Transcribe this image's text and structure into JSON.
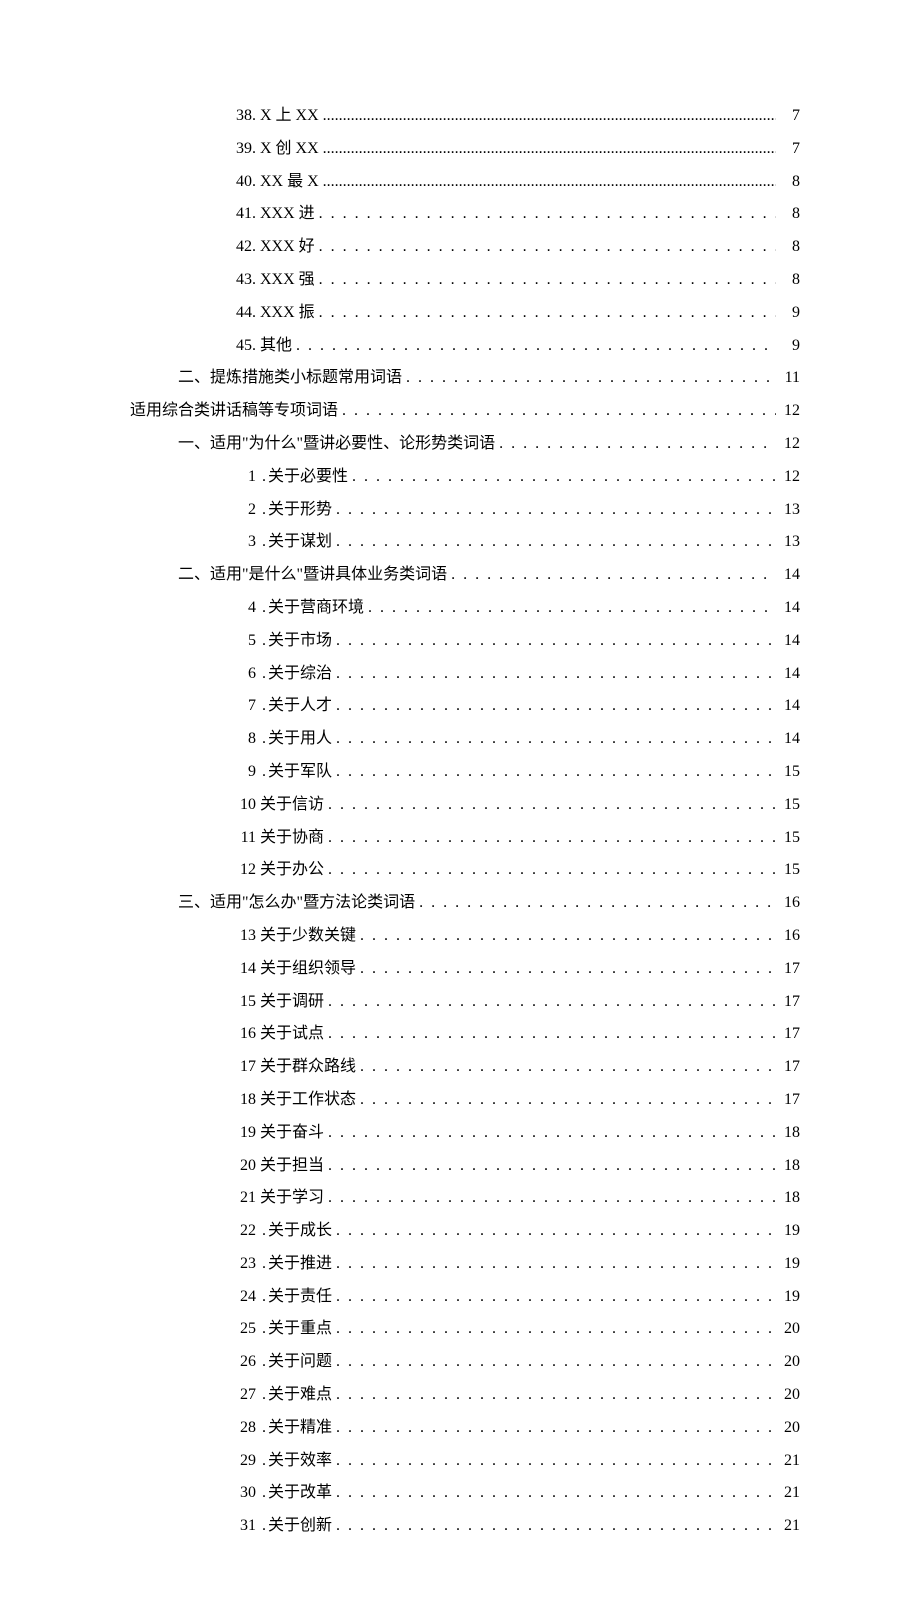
{
  "toc": [
    {
      "indent": 2,
      "num": "38.",
      "sep": "",
      "label": "X 上 XX",
      "tight": true,
      "page": "7"
    },
    {
      "indent": 2,
      "num": "39.",
      "sep": "",
      "label": "X 创 XX",
      "tight": true,
      "page": "7"
    },
    {
      "indent": 2,
      "num": "40.",
      "sep": "",
      "label": "XX 最 X",
      "tight": true,
      "page": "8"
    },
    {
      "indent": 2,
      "num": "41.",
      "sep": "",
      "label": "XXX 进",
      "tight": false,
      "page": "8"
    },
    {
      "indent": 2,
      "num": "42.",
      "sep": "",
      "label": "XXX 好",
      "tight": false,
      "page": "8"
    },
    {
      "indent": 2,
      "num": "43.",
      "sep": "",
      "label": "XXX 强",
      "tight": false,
      "page": "8"
    },
    {
      "indent": 2,
      "num": "44.",
      "sep": "",
      "label": "XXX 振",
      "tight": false,
      "page": "9"
    },
    {
      "indent": 2,
      "num": "45.",
      "sep": "",
      "label": "其他",
      "tight": false,
      "page": "9"
    },
    {
      "indent": 1,
      "num": "",
      "sep": "",
      "label": "二、提炼措施类小标题常用词语",
      "tight": false,
      "page": "11"
    },
    {
      "indent": 0,
      "num": "",
      "sep": "",
      "label": "适用综合类讲话稿等专项词语",
      "tight": false,
      "page": "12"
    },
    {
      "indent": 1,
      "num": "",
      "sep": "",
      "label": "一、适用\"为什么\"暨讲必要性、论形势类词语",
      "tight": false,
      "page": "12"
    },
    {
      "indent": 2,
      "num": "1",
      "sep": ".",
      "label": "关于必要性",
      "tight": false,
      "page": "12"
    },
    {
      "indent": 2,
      "num": "2",
      "sep": ".",
      "label": "关于形势",
      "tight": false,
      "page": "13"
    },
    {
      "indent": 2,
      "num": "3",
      "sep": ".",
      "label": "关于谋划",
      "tight": false,
      "page": "13"
    },
    {
      "indent": 1,
      "num": "",
      "sep": "",
      "label": "二、适用\"是什么\"暨讲具体业务类词语",
      "tight": false,
      "page": "14"
    },
    {
      "indent": 2,
      "num": "4",
      "sep": ".",
      "label": "关于营商环境",
      "tight": false,
      "page": "14"
    },
    {
      "indent": 2,
      "num": "5",
      "sep": ".",
      "label": "关于市场",
      "tight": false,
      "page": "14"
    },
    {
      "indent": 2,
      "num": "6",
      "sep": ".",
      "label": "关于综治",
      "tight": false,
      "page": "14"
    },
    {
      "indent": 2,
      "num": "7",
      "sep": ".",
      "label": "关于人才",
      "tight": false,
      "page": "14"
    },
    {
      "indent": 2,
      "num": "8",
      "sep": ".",
      "label": "关于用人",
      "tight": false,
      "page": "14"
    },
    {
      "indent": 2,
      "num": "9",
      "sep": ".",
      "label": "关于军队",
      "tight": false,
      "page": "15"
    },
    {
      "indent": 2,
      "num": "10",
      "sep": "",
      "label": "关于信访",
      "tight": false,
      "page": "15"
    },
    {
      "indent": 2,
      "num": "11",
      "sep": "",
      "label": "关于协商",
      "tight": false,
      "page": "15"
    },
    {
      "indent": 2,
      "num": "12",
      "sep": "",
      "label": "关于办公",
      "tight": false,
      "page": "15"
    },
    {
      "indent": 1,
      "num": "",
      "sep": "",
      "label": "三、适用\"怎么办\"暨方法论类词语",
      "tight": false,
      "page": "16"
    },
    {
      "indent": 2,
      "num": "13",
      "sep": "",
      "label": "关于少数关键",
      "tight": false,
      "page": "16"
    },
    {
      "indent": 2,
      "num": "14",
      "sep": "",
      "label": "关于组织领导",
      "tight": false,
      "page": "17"
    },
    {
      "indent": 2,
      "num": "15",
      "sep": "",
      "label": "关于调研",
      "tight": false,
      "page": "17"
    },
    {
      "indent": 2,
      "num": "16",
      "sep": "",
      "label": "关于试点",
      "tight": false,
      "page": "17"
    },
    {
      "indent": 2,
      "num": "17",
      "sep": "",
      "label": "关于群众路线",
      "tight": false,
      "page": "17"
    },
    {
      "indent": 2,
      "num": "18",
      "sep": "",
      "label": "关于工作状态",
      "tight": false,
      "page": "17"
    },
    {
      "indent": 2,
      "num": "19",
      "sep": "",
      "label": "关于奋斗",
      "tight": false,
      "page": "18"
    },
    {
      "indent": 2,
      "num": "20",
      "sep": "",
      "label": "关于担当",
      "tight": false,
      "page": "18"
    },
    {
      "indent": 2,
      "num": "21",
      "sep": "",
      "label": "关于学习",
      "tight": false,
      "page": "18"
    },
    {
      "indent": 2,
      "num": "22",
      "sep": ".",
      "label": "关于成长",
      "tight": false,
      "page": "19"
    },
    {
      "indent": 2,
      "num": "23",
      "sep": ".",
      "label": "关于推进",
      "tight": false,
      "page": "19"
    },
    {
      "indent": 2,
      "num": "24",
      "sep": ".",
      "label": "关于责任",
      "tight": false,
      "page": "19"
    },
    {
      "indent": 2,
      "num": "25",
      "sep": ".",
      "label": "关于重点",
      "tight": false,
      "page": "20"
    },
    {
      "indent": 2,
      "num": "26",
      "sep": ".",
      "label": "关于问题",
      "tight": false,
      "page": "20"
    },
    {
      "indent": 2,
      "num": "27",
      "sep": ".",
      "label": "关于难点",
      "tight": false,
      "page": "20"
    },
    {
      "indent": 2,
      "num": "28",
      "sep": ".",
      "label": "关于精准",
      "tight": false,
      "page": "20"
    },
    {
      "indent": 2,
      "num": "29",
      "sep": ".",
      "label": "关于效率",
      "tight": false,
      "page": "21"
    },
    {
      "indent": 2,
      "num": "30",
      "sep": ".",
      "label": "关于改革",
      "tight": false,
      "page": "21"
    },
    {
      "indent": 2,
      "num": "31",
      "sep": ".",
      "label": "关于创新",
      "tight": false,
      "page": "21"
    }
  ]
}
